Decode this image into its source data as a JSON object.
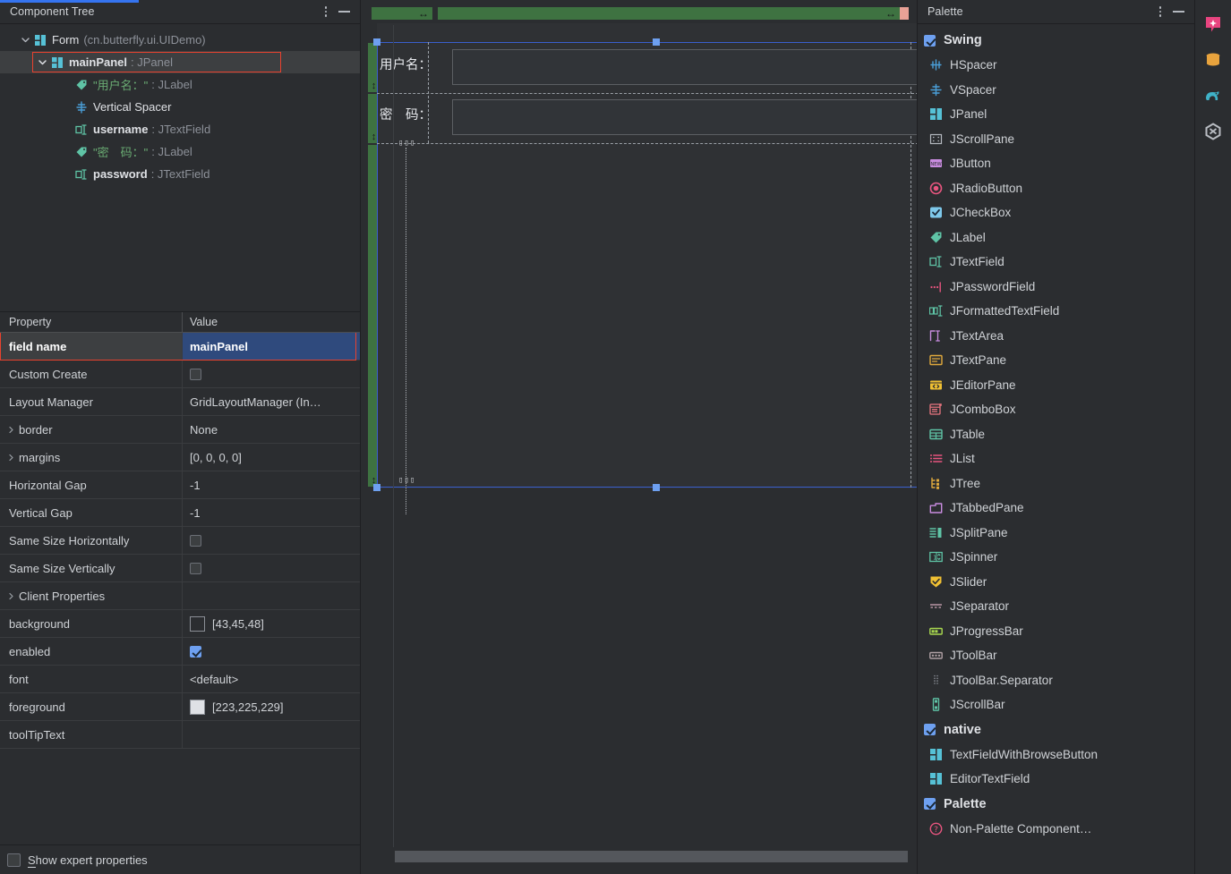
{
  "left_panel": {
    "header": {
      "title": "Component Tree",
      "more_icon": "more-options-icon",
      "minimize_icon": "minimize-icon"
    },
    "tree": [
      {
        "indent": 0,
        "chevron": "expanded",
        "icon": "jpanel-icon",
        "name": "Form",
        "type": "(cn.butterfly.ui.UIDemo)",
        "bold": false,
        "selected": false,
        "type_style": "paren"
      },
      {
        "indent": 1,
        "chevron": "expanded",
        "icon": "jpanel-icon",
        "name": "mainPanel",
        "type": "JPanel",
        "bold": true,
        "selected": true,
        "type_style": "colon"
      },
      {
        "indent": 2,
        "chevron": "none",
        "icon": "jlabel-icon",
        "name": "\"用户名：\"",
        "type": "JLabel",
        "bold": false,
        "selected": false,
        "type_style": "string"
      },
      {
        "indent": 2,
        "chevron": "none",
        "icon": "vspacer-icon",
        "name": "Vertical Spacer",
        "type": "",
        "bold": false,
        "selected": false,
        "type_style": "plain"
      },
      {
        "indent": 2,
        "chevron": "none",
        "icon": "jtextfield-icon",
        "name": "username",
        "type": "JTextField",
        "bold": true,
        "selected": false,
        "type_style": "colon"
      },
      {
        "indent": 2,
        "chevron": "none",
        "icon": "jlabel-icon",
        "name": "\"密　码：\"",
        "type": "JLabel",
        "bold": false,
        "selected": false,
        "type_style": "string"
      },
      {
        "indent": 2,
        "chevron": "none",
        "icon": "jtextfield-icon",
        "name": "password",
        "type": "JTextField",
        "bold": true,
        "selected": false,
        "type_style": "colon"
      }
    ],
    "properties": {
      "col_property": "Property",
      "col_value": "Value",
      "rows": [
        {
          "name": "field name",
          "value": "mainPanel",
          "kind": "text",
          "expandable": false,
          "highlight": true
        },
        {
          "name": "Custom Create",
          "value": "",
          "kind": "checkbox",
          "checked": false,
          "expandable": false,
          "highlight": false
        },
        {
          "name": "Layout Manager",
          "value": "GridLayoutManager (In…",
          "kind": "text",
          "expandable": false,
          "highlight": false
        },
        {
          "name": "border",
          "value": "None",
          "kind": "text",
          "expandable": true,
          "highlight": false
        },
        {
          "name": "margins",
          "value": "[0, 0, 0, 0]",
          "kind": "text",
          "expandable": true,
          "highlight": false
        },
        {
          "name": "Horizontal Gap",
          "value": "-1",
          "kind": "text",
          "expandable": false,
          "highlight": false
        },
        {
          "name": "Vertical Gap",
          "value": "-1",
          "kind": "text",
          "expandable": false,
          "highlight": false
        },
        {
          "name": "Same Size Horizontally",
          "value": "",
          "kind": "checkbox",
          "checked": false,
          "expandable": false,
          "highlight": false
        },
        {
          "name": "Same Size Vertically",
          "value": "",
          "kind": "checkbox",
          "checked": false,
          "expandable": false,
          "highlight": false
        },
        {
          "name": "Client Properties",
          "value": "",
          "kind": "text",
          "expandable": true,
          "highlight": false
        },
        {
          "name": "background",
          "value": "[43,45,48]",
          "kind": "color",
          "swatch": "#2b2d30",
          "expandable": false,
          "highlight": false
        },
        {
          "name": "enabled",
          "value": "",
          "kind": "checkbox",
          "checked": true,
          "expandable": false,
          "highlight": false
        },
        {
          "name": "font",
          "value": "<default>",
          "kind": "text",
          "expandable": false,
          "highlight": false
        },
        {
          "name": "foreground",
          "value": "[223,225,229]",
          "kind": "color",
          "swatch": "#dfe1e5",
          "expandable": false,
          "highlight": false
        },
        {
          "name": "toolTipText",
          "value": "",
          "kind": "text",
          "expandable": false,
          "highlight": false
        }
      ]
    },
    "footer": {
      "checkbox_label": "Show expert properties",
      "checked": false,
      "mnemonic": "S"
    }
  },
  "canvas": {
    "labels": [
      {
        "text": "用户名："
      },
      {
        "text": "密　码："
      }
    ],
    "fields": [
      {
        "name": "username-field"
      },
      {
        "name": "password-field"
      }
    ],
    "vspacer_glyph": "▯▯▯"
  },
  "palette": {
    "header": {
      "title": "Palette",
      "more_icon": "more-options-icon",
      "minimize_icon": "minimize-icon"
    },
    "groups": [
      {
        "label": "Swing",
        "checked": true,
        "items": [
          {
            "label": "HSpacer",
            "icon": "hspacer-icon"
          },
          {
            "label": "VSpacer",
            "icon": "vspacer-icon"
          },
          {
            "label": "JPanel",
            "icon": "jpanel-icon"
          },
          {
            "label": "JScrollPane",
            "icon": "jscrollpane-icon"
          },
          {
            "label": "JButton",
            "icon": "jbutton-icon"
          },
          {
            "label": "JRadioButton",
            "icon": "jradiobutton-icon"
          },
          {
            "label": "JCheckBox",
            "icon": "jcheckbox-icon"
          },
          {
            "label": "JLabel",
            "icon": "jlabel-icon"
          },
          {
            "label": "JTextField",
            "icon": "jtextfield-icon"
          },
          {
            "label": "JPasswordField",
            "icon": "jpasswordfield-icon"
          },
          {
            "label": "JFormattedTextField",
            "icon": "jformattedtextfield-icon"
          },
          {
            "label": "JTextArea",
            "icon": "jtextarea-icon"
          },
          {
            "label": "JTextPane",
            "icon": "jtextpane-icon"
          },
          {
            "label": "JEditorPane",
            "icon": "jeditorpane-icon"
          },
          {
            "label": "JComboBox",
            "icon": "jcombobox-icon"
          },
          {
            "label": "JTable",
            "icon": "jtable-icon"
          },
          {
            "label": "JList",
            "icon": "jlist-icon"
          },
          {
            "label": "JTree",
            "icon": "jtree-icon"
          },
          {
            "label": "JTabbedPane",
            "icon": "jtabbedpane-icon"
          },
          {
            "label": "JSplitPane",
            "icon": "jsplitpane-icon"
          },
          {
            "label": "JSpinner",
            "icon": "jspinner-icon"
          },
          {
            "label": "JSlider",
            "icon": "jslider-icon"
          },
          {
            "label": "JSeparator",
            "icon": "jseparator-icon"
          },
          {
            "label": "JProgressBar",
            "icon": "jprogressbar-icon"
          },
          {
            "label": "JToolBar",
            "icon": "jtoolbar-icon"
          },
          {
            "label": "JToolBar.Separator",
            "icon": "jtoolbar-separator-icon"
          },
          {
            "label": "JScrollBar",
            "icon": "jscrollbar-icon"
          }
        ]
      },
      {
        "label": "native",
        "checked": true,
        "items": [
          {
            "label": "TextFieldWithBrowseButton",
            "icon": "jpanel-icon"
          },
          {
            "label": "EditorTextField",
            "icon": "jpanel-icon"
          }
        ]
      },
      {
        "label": "Palette",
        "checked": true,
        "items": [
          {
            "label": "Non-Palette Component…",
            "icon": "non-palette-icon"
          }
        ]
      }
    ]
  },
  "toolstrip": {
    "buttons": [
      {
        "name": "ai-assistant-icon",
        "color": "#e8447f"
      },
      {
        "name": "database-icon",
        "color": "#e8a33d"
      },
      {
        "name": "gradle-icon",
        "color": "#3fb2c8"
      },
      {
        "name": "maven-icon",
        "color": "#b8bcc2"
      }
    ]
  },
  "colors": {
    "bg": "#2b2d30",
    "accent_blue": "#3574f0",
    "selection_blue": "#2f4a7d",
    "annotation_red": "#e8422e",
    "ruler_green": "#3e7241",
    "ruler_pink": "#e8a196",
    "string_green": "#6aab73"
  }
}
